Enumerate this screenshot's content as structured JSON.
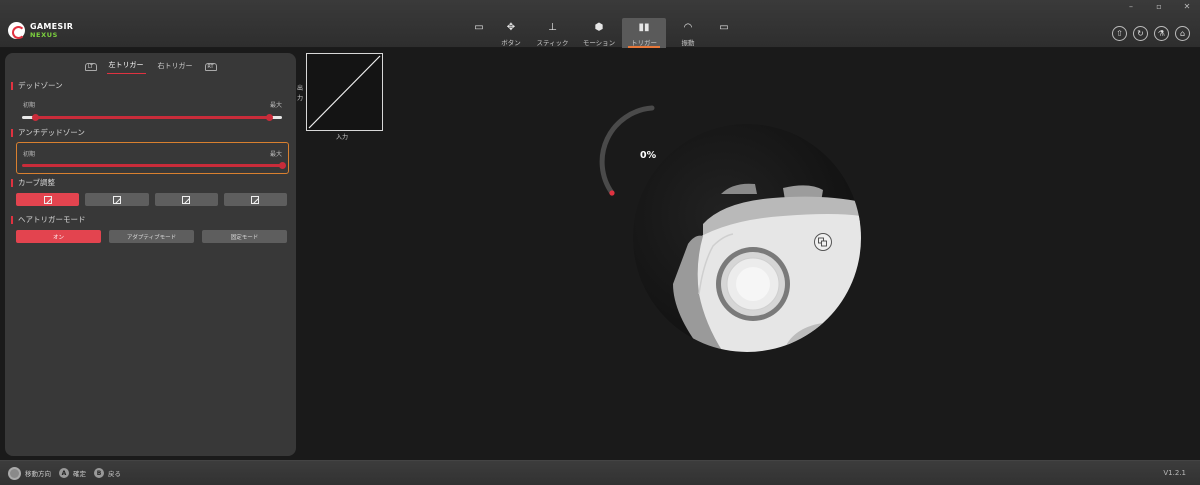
{
  "app": {
    "logo_name": "GAMESIR",
    "logo_sub": "NEXUS",
    "window_controls": [
      "–",
      "▫",
      "✕"
    ]
  },
  "nav": {
    "tabs": [
      {
        "label": "",
        "icon": "controller-home-icon"
      },
      {
        "label": "ボタン",
        "icon": "buttons-icon"
      },
      {
        "label": "スティック",
        "icon": "stick-icon"
      },
      {
        "label": "モーション",
        "icon": "motion-icon"
      },
      {
        "label": "トリガー",
        "icon": "trigger-icon",
        "active": true
      },
      {
        "label": "振動",
        "icon": "vibration-icon"
      },
      {
        "label": "",
        "icon": "controller-settings-icon"
      }
    ],
    "right_icons": [
      "upload-icon",
      "refresh-icon",
      "flask-icon",
      "home-icon"
    ]
  },
  "panel": {
    "lt_icon": "LT",
    "rt_icon": "RT",
    "left_trigger_tab": "左トリガー",
    "right_trigger_tab": "右トリガー",
    "deadzone": {
      "title": "デッドゾーン",
      "min_label": "初期",
      "max_label": "最大",
      "min_value": 0.05,
      "max_value": 0.95
    },
    "anti_deadzone": {
      "title": "アンチデッドゾーン",
      "min_label": "初期",
      "max_label": "最大",
      "value": 0
    },
    "curve": {
      "title": "カーブ調整",
      "options": [
        "linear",
        "ease-out",
        "ease-in",
        "custom"
      ],
      "selected": 0
    },
    "hair_trigger": {
      "title": "ヘアトリガーモード",
      "options": [
        "オン",
        "アダプティブモード",
        "固定モード"
      ],
      "selected": 0
    }
  },
  "graph": {
    "y_label": "出力",
    "x_label": "入力"
  },
  "gauge": {
    "percent": "0%",
    "value": 0,
    "accent_color": "#e03240"
  },
  "footer": {
    "move_label": "移動方向",
    "confirm_key": "A",
    "confirm_label": "確定",
    "back_key": "B",
    "back_label": "戻る",
    "version": "V1.2.1"
  },
  "colors": {
    "accent": "#c92c3a",
    "active_button": "#e3444f",
    "tab_underline": "#e8783a",
    "highlight_border": "#d9802f"
  }
}
